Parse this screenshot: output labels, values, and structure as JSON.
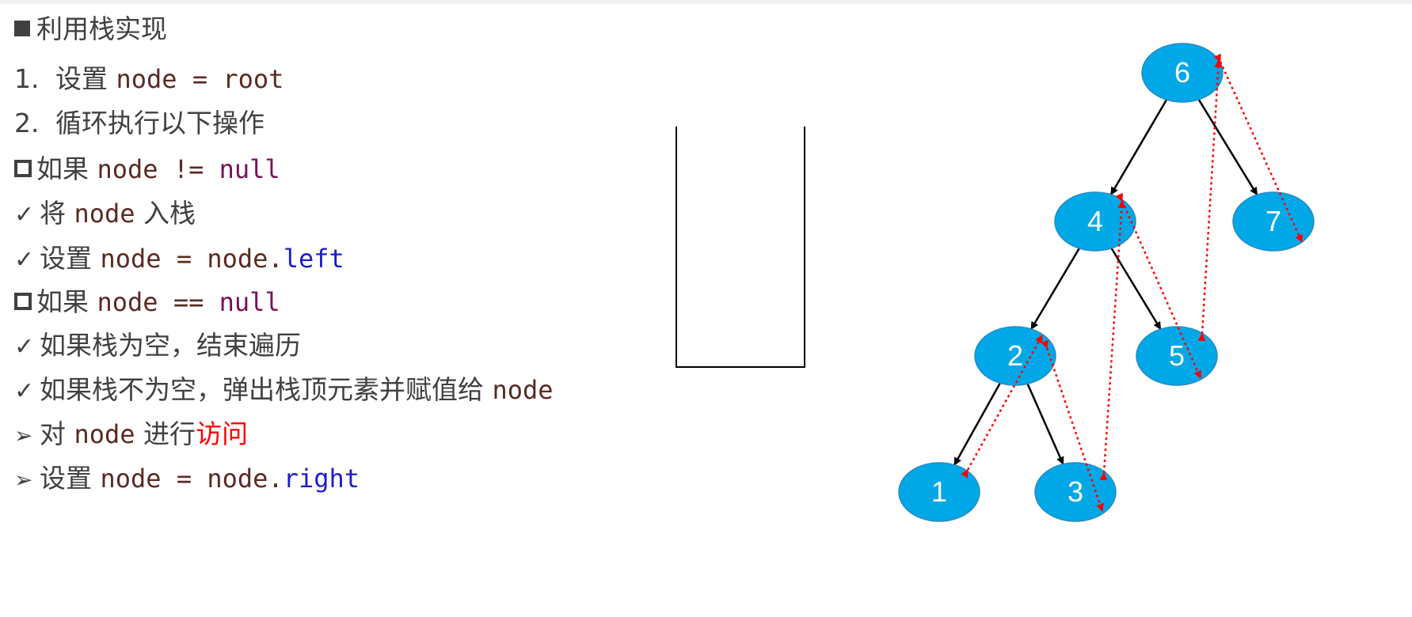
{
  "lines": [
    {
      "bullet": "square-solid",
      "parts": [
        {
          "t": "利用栈实现"
        }
      ]
    },
    {
      "bullet": "1.",
      "parts": [
        {
          "t": "设置 "
        },
        {
          "t": "node = root",
          "code": true,
          "cls": "code-brown"
        }
      ]
    },
    {
      "bullet": "2.",
      "parts": [
        {
          "t": "循环执行以下操作"
        }
      ]
    },
    {
      "bullet": "square-hollow",
      "parts": [
        {
          "t": "如果 "
        },
        {
          "t": "node != ",
          "code": true,
          "cls": "code-brown"
        },
        {
          "t": "null",
          "code": true,
          "cls": "kw-null"
        }
      ]
    },
    {
      "bullet": "check",
      "parts": [
        {
          "t": "将 "
        },
        {
          "t": "node",
          "code": true,
          "cls": "code-brown"
        },
        {
          "t": "  入栈"
        }
      ]
    },
    {
      "bullet": "check",
      "parts": [
        {
          "t": "设置 "
        },
        {
          "t": "node = node.",
          "code": true,
          "cls": "code-brown"
        },
        {
          "t": "left",
          "code": true,
          "cls": "kw-blue"
        }
      ]
    },
    {
      "bullet": "square-hollow",
      "parts": [
        {
          "t": "如果 "
        },
        {
          "t": "node == ",
          "code": true,
          "cls": "code-brown"
        },
        {
          "t": "null",
          "code": true,
          "cls": "kw-null"
        }
      ]
    },
    {
      "bullet": "check",
      "parts": [
        {
          "t": "如果栈为空，结束遍历"
        }
      ]
    },
    {
      "bullet": "check",
      "parts": [
        {
          "t": "如果栈不为空，弹出栈顶元素并赋值给 "
        },
        {
          "t": "node",
          "code": true,
          "cls": "code-brown"
        }
      ]
    },
    {
      "bullet": "arrowhead",
      "parts": [
        {
          "t": "对 "
        },
        {
          "t": "node",
          "code": true,
          "cls": "code-brown"
        },
        {
          "t": "  进行"
        },
        {
          "t": "访问",
          "cls": "kw-red"
        }
      ]
    },
    {
      "bullet": "arrowhead",
      "parts": [
        {
          "t": "设置 "
        },
        {
          "t": "node = node.",
          "code": true,
          "cls": "code-brown"
        },
        {
          "t": "right",
          "code": true,
          "cls": "kw-blue"
        }
      ]
    }
  ],
  "tree": {
    "nodes": [
      {
        "id": "n6",
        "label": "6"
      },
      {
        "id": "n4",
        "label": "4"
      },
      {
        "id": "n7",
        "label": "7"
      },
      {
        "id": "n2",
        "label": "2"
      },
      {
        "id": "n5",
        "label": "5"
      },
      {
        "id": "n1",
        "label": "1"
      },
      {
        "id": "n3",
        "label": "3"
      }
    ],
    "edges": [
      [
        "n6",
        "n4"
      ],
      [
        "n6",
        "n7"
      ],
      [
        "n4",
        "n2"
      ],
      [
        "n4",
        "n5"
      ],
      [
        "n2",
        "n1"
      ],
      [
        "n2",
        "n3"
      ]
    ],
    "traversal_links": [
      [
        "n1",
        "n2"
      ],
      [
        "n2",
        "n3"
      ],
      [
        "n3",
        "n4"
      ],
      [
        "n4",
        "n5"
      ],
      [
        "n5",
        "n6"
      ],
      [
        "n6",
        "n7"
      ]
    ],
    "node_color": "#00a8e8",
    "node_stroke": "#2b8ac2",
    "edge_color": "#000000",
    "traversal_color": "#ff0000"
  },
  "stack": {
    "label": "",
    "items": []
  }
}
